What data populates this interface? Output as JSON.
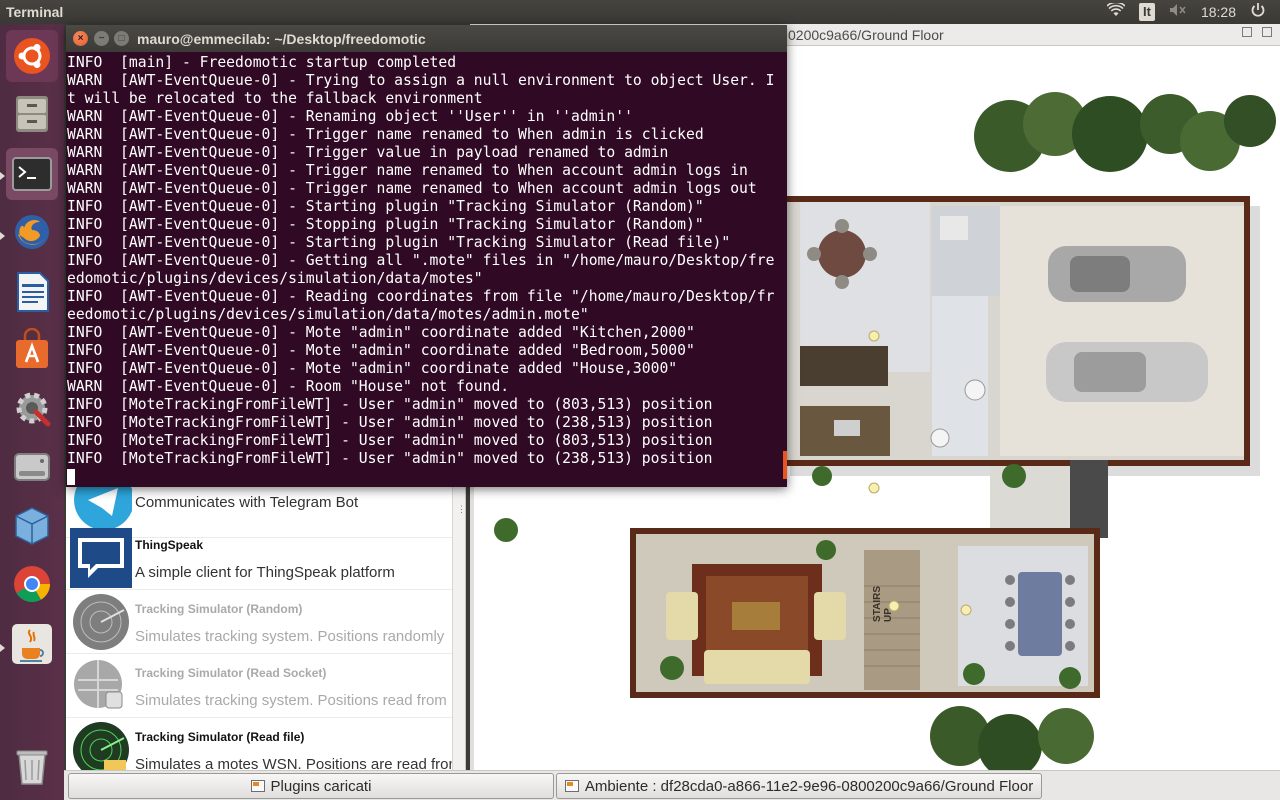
{
  "top_panel": {
    "app_title": "Terminal",
    "keyboard_layout": "It",
    "clock": "18:28",
    "icons": [
      "wifi-icon",
      "volume-muted-icon",
      "power-icon"
    ]
  },
  "launcher": {
    "items": [
      "ubuntu-dash",
      "files",
      "terminal",
      "firefox",
      "libreoffice-writer",
      "ubuntu-software",
      "system-settings",
      "disks",
      "virtualbox",
      "chrome",
      "java",
      "trash"
    ]
  },
  "terminal": {
    "title": "mauro@emmecilab: ~/Desktop/freedomotic",
    "lines": [
      "INFO  [main] - Freedomotic startup completed",
      "WARN  [AWT-EventQueue-0] - Trying to assign a null environment to object User. I",
      "t will be relocated to the fallback environment",
      "WARN  [AWT-EventQueue-0] - Renaming object ''User'' in ''admin''",
      "WARN  [AWT-EventQueue-0] - Trigger name renamed to When admin is clicked",
      "WARN  [AWT-EventQueue-0] - Trigger value in payload renamed to admin",
      "WARN  [AWT-EventQueue-0] - Trigger name renamed to When account admin logs in",
      "WARN  [AWT-EventQueue-0] - Trigger name renamed to When account admin logs out",
      "INFO  [AWT-EventQueue-0] - Starting plugin \"Tracking Simulator (Random)\"",
      "INFO  [AWT-EventQueue-0] - Stopping plugin \"Tracking Simulator (Random)\"",
      "INFO  [AWT-EventQueue-0] - Starting plugin \"Tracking Simulator (Read file)\"",
      "INFO  [AWT-EventQueue-0] - Getting all \".mote\" files in \"/home/mauro/Desktop/fre",
      "edomotic/plugins/devices/simulation/data/motes\"",
      "INFO  [AWT-EventQueue-0] - Reading coordinates from file \"/home/mauro/Desktop/fr",
      "eedomotic/plugins/devices/simulation/data/motes/admin.mote\"",
      "INFO  [AWT-EventQueue-0] - Mote \"admin\" coordinate added \"Kitchen,2000\"",
      "INFO  [AWT-EventQueue-0] - Mote \"admin\" coordinate added \"Bedroom,5000\"",
      "INFO  [AWT-EventQueue-0] - Mote \"admin\" coordinate added \"House,3000\"",
      "WARN  [AWT-EventQueue-0] - Room \"House\" not found.",
      "INFO  [MoteTrackingFromFileWT] - User \"admin\" moved to (803,513) position",
      "INFO  [MoteTrackingFromFileWT] - User \"admin\" moved to (238,513) position",
      "INFO  [MoteTrackingFromFileWT] - User \"admin\" moved to (803,513) position",
      "INFO  [MoteTrackingFromFileWT] - User \"admin\" moved to (238,513) position"
    ]
  },
  "env_window": {
    "title_visible": "0200c9a66/Ground Floor",
    "stairs_label": "STAIRS\nUP"
  },
  "plugins": {
    "rows": [
      {
        "name": "",
        "desc": "Communicates with Telegram Bot",
        "icon": "telegram-icon",
        "enabled": true
      },
      {
        "name": "ThingSpeak",
        "desc": "A simple client for ThingSpeak platform",
        "icon": "thingspeak-icon",
        "enabled": true
      },
      {
        "name": "Tracking Simulator (Random)",
        "desc": "Simulates tracking system. Positions randomly",
        "icon": "radar-icon",
        "enabled": false
      },
      {
        "name": "Tracking Simulator (Read Socket)",
        "desc": "Simulates tracking system. Positions read from",
        "icon": "globe-plug-icon",
        "enabled": false
      },
      {
        "name": "Tracking Simulator (Read file)",
        "desc": "Simulates a motes WSN. Positions are read from",
        "icon": "radar-green-icon",
        "enabled": true
      }
    ]
  },
  "taskbar": {
    "plugins_button": "Plugins caricati",
    "environment_button": "Ambiente : df28cda0-a866-11e2-9e96-0800200c9a66/Ground Floor"
  }
}
